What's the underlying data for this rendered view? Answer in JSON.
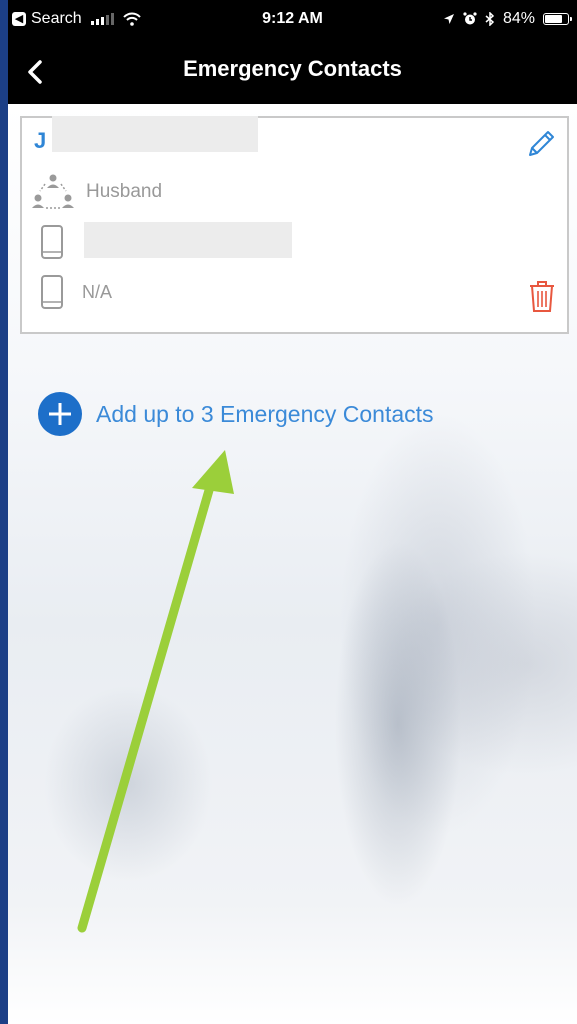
{
  "status_bar": {
    "back_app": "Search",
    "time": "9:12 AM",
    "battery_text": "84%",
    "battery_level": 0.84
  },
  "nav": {
    "title": "Emergency Contacts",
    "back_icon": "chevron-left-icon"
  },
  "contact": {
    "name_visible": "J",
    "relationship": "Husband",
    "phone2": "N/A",
    "name_color": "#2f86d6",
    "edit_icon": "pencil-icon",
    "delete_icon": "trash-icon",
    "delete_color": "#e8573f"
  },
  "add_contact": {
    "label": "Add up to 3 Emergency Contacts",
    "icon": "plus-circle-icon",
    "accent": "#1d6fc9"
  },
  "annotation": {
    "arrow_color": "#9bcf3a"
  }
}
